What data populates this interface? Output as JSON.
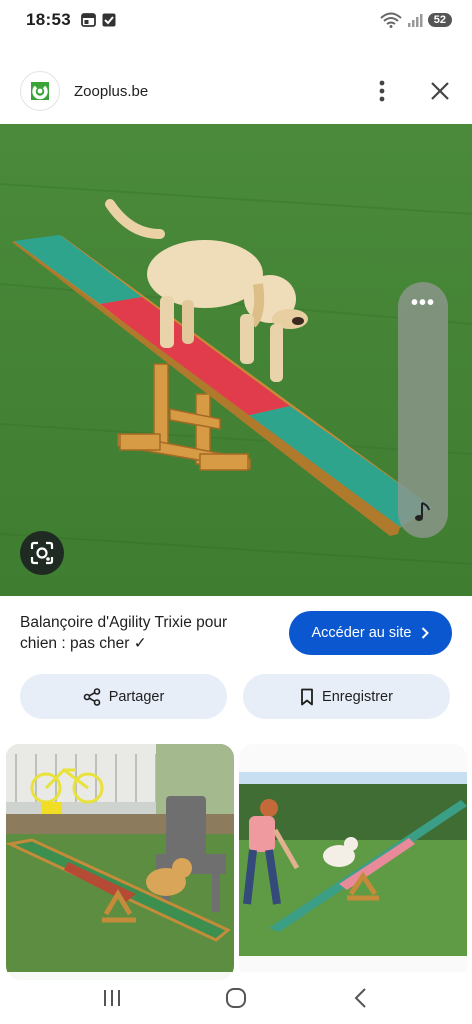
{
  "status": {
    "time": "18:53",
    "battery": "52"
  },
  "source": {
    "name": "Zooplus.be"
  },
  "result": {
    "title": "Balançoire d'Agility Trixie pour chien : pas cher ✓",
    "visit_label": "Accéder au site",
    "share_label": "Partager",
    "save_label": "Enregistrer"
  },
  "icons": {
    "favicon": "zooplus-logo-icon",
    "more": "more-vert-icon",
    "close": "close-icon",
    "lens": "lens-icon",
    "share": "share-icon",
    "bookmark": "bookmark-icon",
    "chevron": "chevron-right-icon",
    "music": "music-note-icon"
  },
  "colors": {
    "accent": "#0b57d0",
    "pill": "#e8eef8"
  }
}
